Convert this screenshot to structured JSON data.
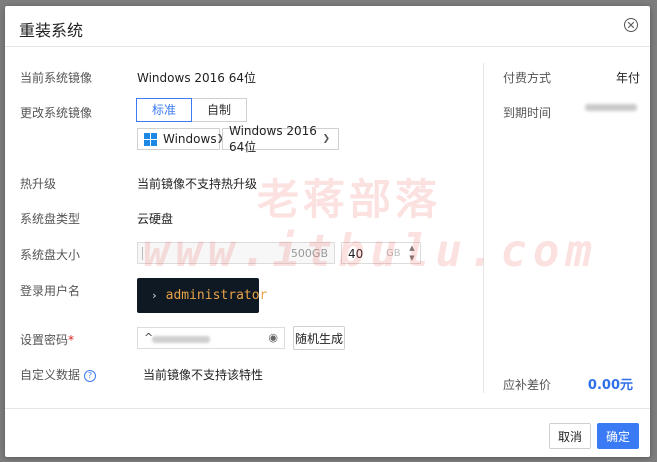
{
  "dialog": {
    "title": "重装系统"
  },
  "form": {
    "current_image_label": "当前系统镜像",
    "current_image_value": "Windows 2016 64位",
    "change_image_label": "更改系统镜像",
    "tabs": [
      "标准",
      "自制"
    ],
    "active_tab": "标准",
    "os_select": "Windows",
    "version_select": "Windows 2016 64位",
    "hot_upgrade_label": "热升级",
    "hot_upgrade_value": "当前镜像不支持热升级",
    "disk_type_label": "系统盘类型",
    "disk_type_value": "云硬盘",
    "disk_size_label": "系统盘大小",
    "disk_max": "500GB",
    "disk_size_value": "40",
    "disk_size_unit": "GB",
    "login_user_label": "登录用户名",
    "login_user_value": "administrator",
    "password_label": "设置密码",
    "password_required_mark": "*",
    "password_caret": "^",
    "random_button": "随机生成",
    "custom_data_label": "自定义数据",
    "custom_data_value": "当前镜像不支持该特性"
  },
  "summary": {
    "pay_method_label": "付费方式",
    "pay_method_value": "年付",
    "expire_label": "到期时间",
    "diff_label": "应补差价",
    "diff_value": "0.00元"
  },
  "footer": {
    "cancel": "取消",
    "confirm": "确定"
  },
  "watermark": {
    "line1": "老蒋部落",
    "line2": "www.itbulu.com"
  },
  "icons": {
    "close": "close-icon",
    "chevron": "chevron-down-icon",
    "eye": "eye-icon",
    "help": "help-icon",
    "windows": "windows-logo-icon",
    "prompt": "chevron-right-icon"
  },
  "colors": {
    "accent": "#3a7bf5",
    "required": "#e02020",
    "console_bg": "#0f1923",
    "console_text": "#e8a248"
  }
}
